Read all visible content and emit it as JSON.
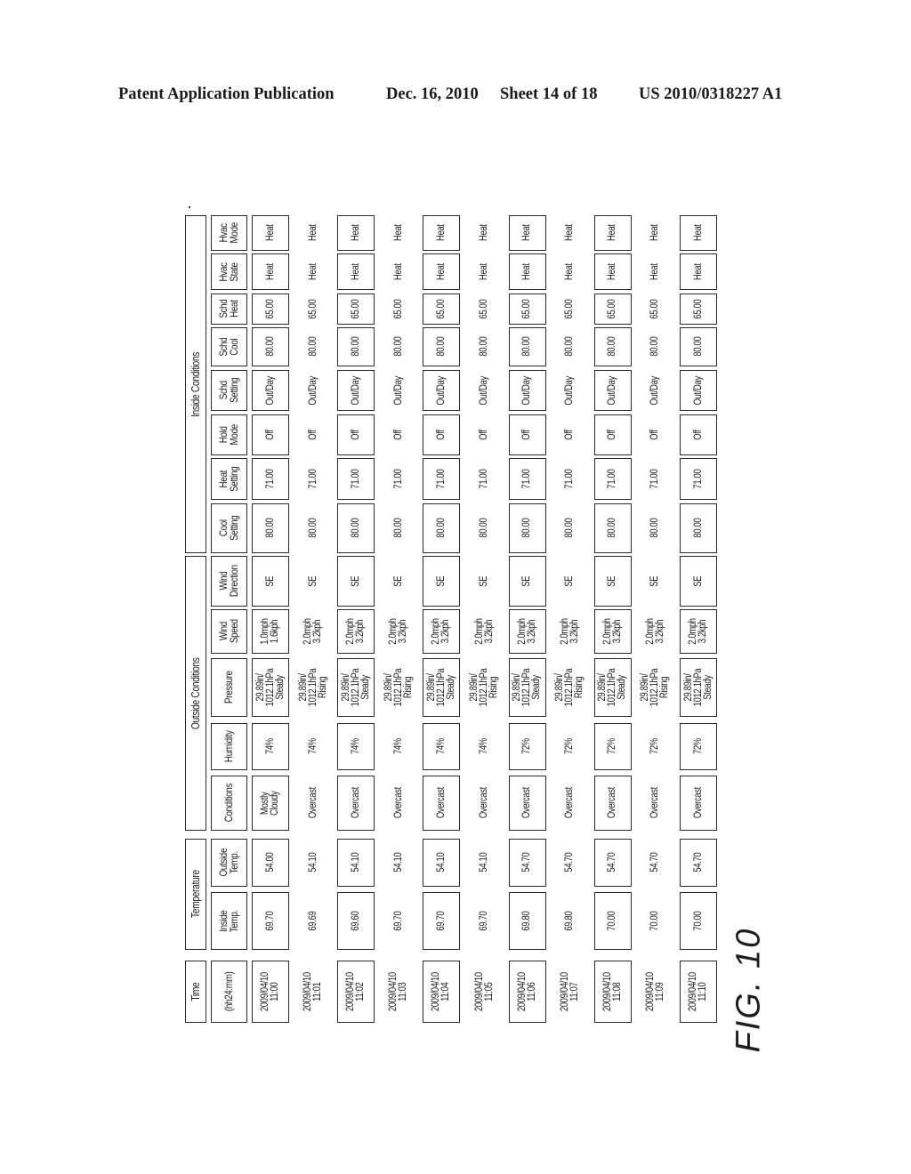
{
  "header": {
    "publication": "Patent Application Publication",
    "date": "Dec. 16, 2010",
    "sheet": "Sheet 14 of 18",
    "pub_number": "US 2010/0318227 A1"
  },
  "figure_label": "FIG. 10",
  "table": {
    "groups": [
      {
        "key": "time",
        "label": "Time"
      },
      {
        "key": "temperature",
        "label": "Temperature"
      },
      {
        "key": "outside",
        "label": "Outside Conditions"
      },
      {
        "key": "inside",
        "label": "Inside Conditions"
      }
    ],
    "columns": [
      {
        "key": "time",
        "label": "(hh24:mm)"
      },
      {
        "key": "inside_temp",
        "label": "Inside\nTemp."
      },
      {
        "key": "outside_temp",
        "label": "Outside\nTemp."
      },
      {
        "key": "conditions",
        "label": "Conditions"
      },
      {
        "key": "humidity",
        "label": "Humidity"
      },
      {
        "key": "pressure",
        "label": "Pressure"
      },
      {
        "key": "wind_speed",
        "label": "Wind\nSpeed"
      },
      {
        "key": "wind_direction",
        "label": "Wind\nDirection"
      },
      {
        "key": "cool_setting",
        "label": "Cool\nSetting"
      },
      {
        "key": "heat_setting",
        "label": "Heat\nSetting"
      },
      {
        "key": "hold_mode",
        "label": "Hold\nMode"
      },
      {
        "key": "schd_setting",
        "label": "Schd\nSetting"
      },
      {
        "key": "schd_cool",
        "label": "Schd\nCool"
      },
      {
        "key": "schd_heat",
        "label": "Schd\nHeat"
      },
      {
        "key": "hvac_state",
        "label": "Hvac\nState"
      },
      {
        "key": "hvac_mode",
        "label": "Hvac\nMode"
      }
    ],
    "rows": [
      [
        "2009/04/10\n11:00",
        "69.70",
        "54.00",
        "Mostly\nCloudy",
        "74%",
        "29.89in/\n1012.1hPa\nSteady",
        "1.0mph\n1.6kph",
        "SE",
        "80.00",
        "71.00",
        "Off",
        "Out/Day",
        "80.00",
        "65.00",
        "Heat",
        "Heat"
      ],
      [
        "2009/04/10\n11:01",
        "69.69",
        "54.10",
        "Overcast",
        "74%",
        "29.89in/\n1012.1hPa\nRising",
        "2.0mph\n3.2kph",
        "SE",
        "80.00",
        "71.00",
        "Off",
        "Out/Day",
        "80.00",
        "65.00",
        "Heat",
        "Heat"
      ],
      [
        "2009/04/10\n11:02",
        "69.60",
        "54.10",
        "Overcast",
        "74%",
        "29.89in/\n1012.1hPa\nSteady",
        "2.0mph\n3.2kph",
        "SE",
        "80.00",
        "71.00",
        "Off",
        "Out/Day",
        "80.00",
        "65.00",
        "Heat",
        "Heat"
      ],
      [
        "2009/04/10\n11:03",
        "69.70",
        "54.10",
        "Overcast",
        "74%",
        "29.89in/\n1012.1hPa\nRising",
        "2.0mph\n3.2kph",
        "SE",
        "80.00",
        "71.00",
        "Off",
        "Out/Day",
        "80.00",
        "65.00",
        "Heat",
        "Heat"
      ],
      [
        "2009/04/10\n11:04",
        "69.70",
        "54.10",
        "Overcast",
        "74%",
        "29.89in/\n1012.1hPa\nSteady",
        "2.0mph\n3.2kph",
        "SE",
        "80.00",
        "71.00",
        "Off",
        "Out/Day",
        "80.00",
        "65.00",
        "Heat",
        "Heat"
      ],
      [
        "2009/04/10\n11:05",
        "69.70",
        "54.10",
        "Overcast",
        "74%",
        "29.89in/\n1012.1hPa\nRising",
        "2.0mph\n3.2kph",
        "SE",
        "80.00",
        "71.00",
        "Off",
        "Out/Day",
        "80.00",
        "65.00",
        "Heat",
        "Heat"
      ],
      [
        "2009/04/10\n11:06",
        "69.80",
        "54.70",
        "Overcast",
        "72%",
        "29.89in/\n1012.1hPa\nSteady",
        "2.0mph\n3.2kph",
        "SE",
        "80.00",
        "71.00",
        "Off",
        "Out/Day",
        "80.00",
        "65.00",
        "Heat",
        "Heat"
      ],
      [
        "2009/04/10\n11:07",
        "69.80",
        "54.70",
        "Overcast",
        "72%",
        "29.89in/\n1012.1hPa\nRising",
        "2.0mph\n3.2kph",
        "SE",
        "80.00",
        "71.00",
        "Off",
        "Out/Day",
        "80.00",
        "65.00",
        "Heat",
        "Heat"
      ],
      [
        "2009/04/10\n11:08",
        "70.00",
        "54.70",
        "Overcast",
        "72%",
        "29.89in/\n1012.1hPa\nSteady",
        "2.0mph\n3.2kph",
        "SE",
        "80.00",
        "71.00",
        "Off",
        "Out/Day",
        "80.00",
        "65.00",
        "Heat",
        "Heat"
      ],
      [
        "2009/04/10\n11:09",
        "70.00",
        "54.70",
        "Overcast",
        "72%",
        "29.89in/\n1012.1hPa\nRising",
        "2.0mph\n3.2kph",
        "SE",
        "80.00",
        "71.00",
        "Off",
        "Out/Day",
        "80.00",
        "65.00",
        "Heat",
        "Heat"
      ],
      [
        "2009/04/10\n11:10",
        "70.00",
        "54.70",
        "Overcast",
        "72%",
        "29.89in/\n1012.1hPa\nSteady",
        "2.0mph\n3.2kph",
        "SE",
        "80.00",
        "71.00",
        "Off",
        "Out/Day",
        "80.00",
        "65.00",
        "Heat",
        "Heat"
      ]
    ]
  }
}
